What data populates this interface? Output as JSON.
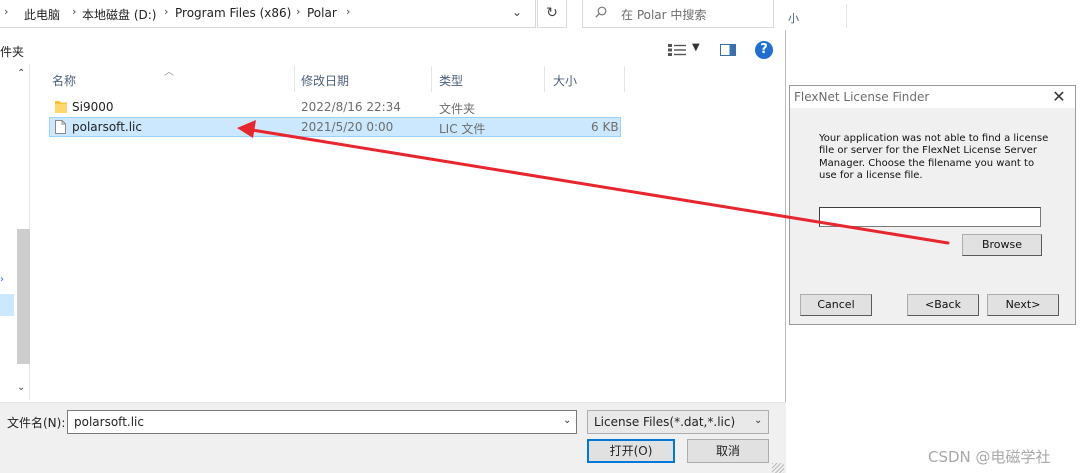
{
  "breadcrumb": {
    "items": [
      "此电脑",
      "本地磁盘 (D:)",
      "Program Files (x86)",
      "Polar"
    ]
  },
  "search": {
    "placeholder": "在 Polar 中搜索"
  },
  "toolbar": {
    "new_folder": "件夹",
    "help": "?"
  },
  "columns": {
    "name": "名称",
    "modified": "修改日期",
    "type": "类型",
    "size": "大小"
  },
  "files": [
    {
      "name": "Si9000",
      "modified": "2022/8/16 22:34",
      "type": "文件夹",
      "size": "",
      "kind": "folder",
      "selected": false
    },
    {
      "name": "polarsoft.lic",
      "modified": "2021/5/20 0:00",
      "type": "LIC 文件",
      "size": "6 KB",
      "kind": "file",
      "selected": true
    }
  ],
  "bottom": {
    "filename_label": "文件名(N):",
    "filename_value": "polarsoft.lic",
    "filter": "License Files(*.dat,*.lic)",
    "open": "打开(O)",
    "cancel": "取消"
  },
  "background_window": {
    "size_header": "小"
  },
  "flexnet": {
    "title": "FlexNet License Finder",
    "message": "Your application was not able to find a license file or server for the FlexNet License Server Manager.  Choose the filename you want to use for a  license file.",
    "input_value": "",
    "browse": "Browse",
    "cancel": "Cancel",
    "back": "<Back",
    "next": "Next>"
  },
  "annotation": {
    "arrow_color": "#e8262e"
  },
  "watermark": "CSDN @电磁学社",
  "colors": {
    "selection": "#cce8ff",
    "accent": "#0078d7"
  },
  "icons": [
    "chevron-down-icon",
    "refresh-icon",
    "search-icon",
    "view-icon",
    "preview-pane-icon",
    "help-icon",
    "folder-icon",
    "file-icon",
    "close-icon"
  ]
}
